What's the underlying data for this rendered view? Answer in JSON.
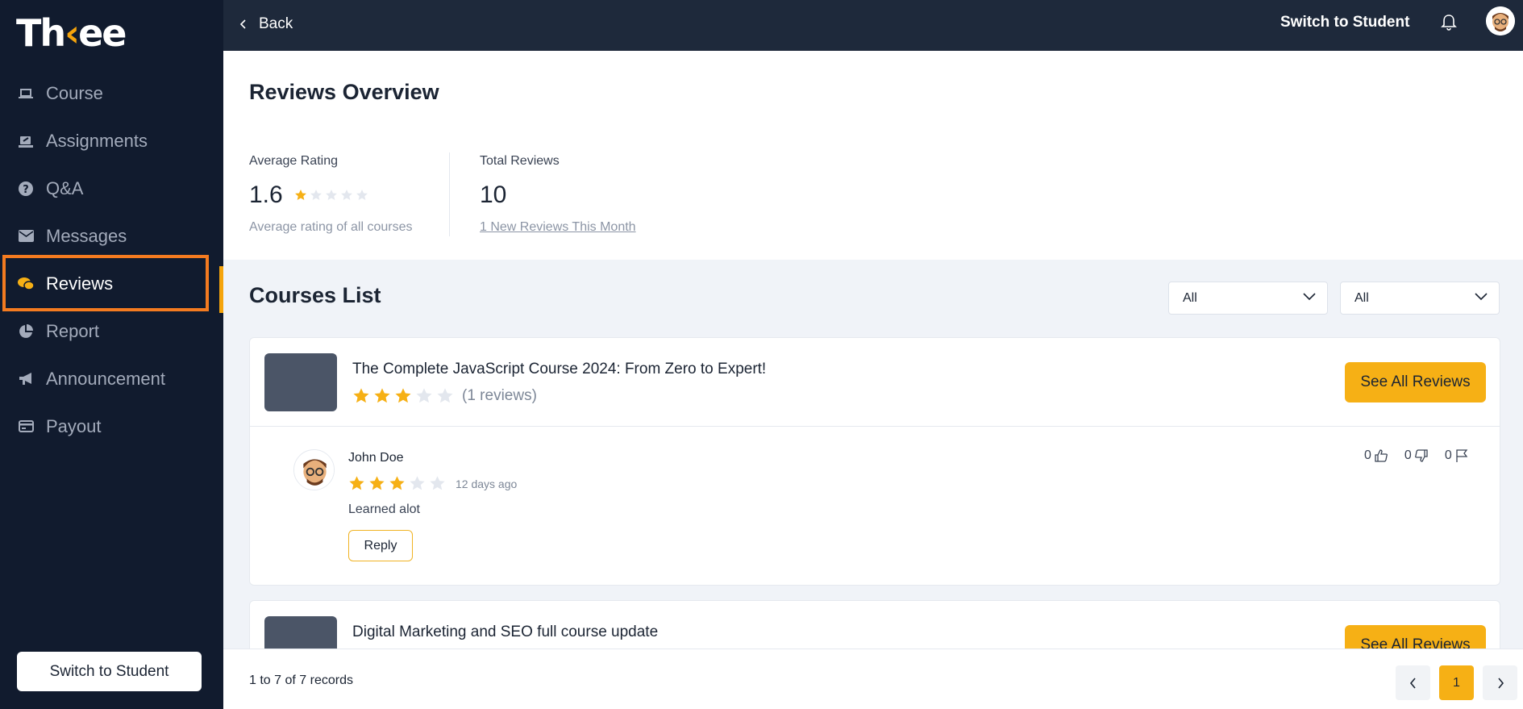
{
  "app": {
    "logo": {
      "part1": "Th",
      "part2": "‹",
      "part3": "ee"
    }
  },
  "colors": {
    "accent": "#f6b015",
    "sidebar_bg": "#111b2e",
    "topbar_bg": "#1e293b",
    "highlight": "#f47b20"
  },
  "sidebar": {
    "items": [
      {
        "label": "Course",
        "icon": "laptop-icon"
      },
      {
        "label": "Assignments",
        "icon": "assignment-icon"
      },
      {
        "label": "Q&A",
        "icon": "question-icon"
      },
      {
        "label": "Messages",
        "icon": "envelope-icon"
      },
      {
        "label": "Reviews",
        "icon": "chat-icon",
        "active": true
      },
      {
        "label": "Report",
        "icon": "pie-chart-icon"
      },
      {
        "label": "Announcement",
        "icon": "megaphone-icon"
      },
      {
        "label": "Payout",
        "icon": "credit-card-icon"
      }
    ],
    "switch_label": "Switch to Student"
  },
  "topbar": {
    "back_label": "Back",
    "switch_label": "Switch to Student"
  },
  "overview": {
    "title": "Reviews Overview",
    "average": {
      "label": "Average Rating",
      "value": "1.6",
      "rating": 1,
      "max": 5,
      "sub": "Average rating of all courses"
    },
    "total": {
      "label": "Total Reviews",
      "value": "10",
      "sub": "1 New Reviews This Month"
    }
  },
  "courses": {
    "title": "Courses List",
    "filters": [
      {
        "value": "All"
      },
      {
        "value": "All"
      }
    ],
    "items": [
      {
        "title": "The Complete JavaScript Course 2024: From Zero to Expert!",
        "rating": 3,
        "reviews_label": "(1 reviews)",
        "button": "See All Reviews",
        "review": {
          "name": "John Doe",
          "rating": 3,
          "time": "12 days ago",
          "text": "Learned alot",
          "reply_label": "Reply",
          "likes": "0",
          "dislikes": "0",
          "flags": "0"
        }
      },
      {
        "title": "Digital Marketing and SEO full course update",
        "button": "See All Reviews"
      }
    ]
  },
  "footer": {
    "records": "1 to 7 of 7 records",
    "current_page": "1"
  }
}
